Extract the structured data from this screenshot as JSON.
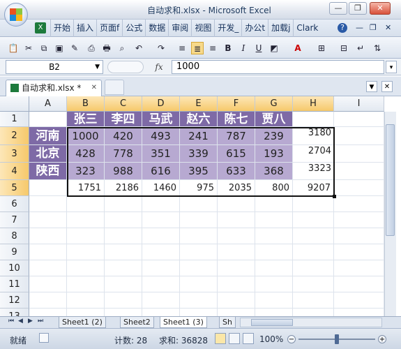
{
  "window": {
    "title": "自动求和.xlsx - Microsoft Excel",
    "minimize": "—",
    "restore": "❐",
    "close": "✕"
  },
  "ribbon": {
    "tabs": [
      "开始",
      "插入",
      "页面f",
      "公式",
      "数据",
      "审阅",
      "视图",
      "开发_",
      "办公t",
      "加载j",
      "Clark"
    ],
    "help": "?",
    "min_label": "—",
    "restore_label": "❐",
    "close_label": "✕"
  },
  "toolbar": {
    "icons": [
      "paste-icon",
      "cut-icon",
      "copy-icon",
      "save-icon",
      "format-painter-icon",
      "print-preview-icon",
      "print-icon",
      "zoom-icon",
      "undo-icon",
      "redo-icon",
      "align-left-icon",
      "align-center-icon",
      "align-right-icon",
      "bold-icon",
      "italic-icon",
      "underline-icon",
      "fill-color-icon",
      "font-color-icon",
      "borders-icon",
      "merge-icon",
      "wrap-icon",
      "sort-icon"
    ]
  },
  "formula_bar": {
    "name_box": "B2",
    "fx": "fx",
    "value": "1000"
  },
  "document": {
    "tab_label": "自动求和.xlsx *",
    "tab_close": "✕"
  },
  "sheet": {
    "columns": [
      "A",
      "B",
      "C",
      "D",
      "E",
      "F",
      "G",
      "H",
      "I"
    ],
    "rows": [
      "1",
      "2",
      "3",
      "4",
      "5",
      "6",
      "7",
      "8",
      "9",
      "10",
      "11",
      "12",
      "13"
    ],
    "header_names": [
      "张三",
      "李四",
      "马武",
      "赵六",
      "陈七",
      "贾八"
    ],
    "provinces": [
      "河南",
      "北京",
      "陕西"
    ],
    "data": [
      [
        1000,
        420,
        493,
        241,
        787,
        239
      ],
      [
        428,
        778,
        351,
        339,
        615,
        193
      ],
      [
        323,
        988,
        616,
        395,
        633,
        368
      ]
    ],
    "row_totals": [
      3180,
      2704,
      3323
    ],
    "column_totals": [
      1751,
      2186,
      1460,
      975,
      2035,
      800
    ],
    "grand_total": 9207,
    "selected_cell": "B2"
  },
  "sheet_tabs": [
    "Sheet1 (2)",
    "Sheet2",
    "Sheet1 (3)",
    "Sh"
  ],
  "status": {
    "mode": "就绪",
    "count": "计数: 28",
    "sum": "求和: 36828",
    "zoom": "100%"
  }
}
